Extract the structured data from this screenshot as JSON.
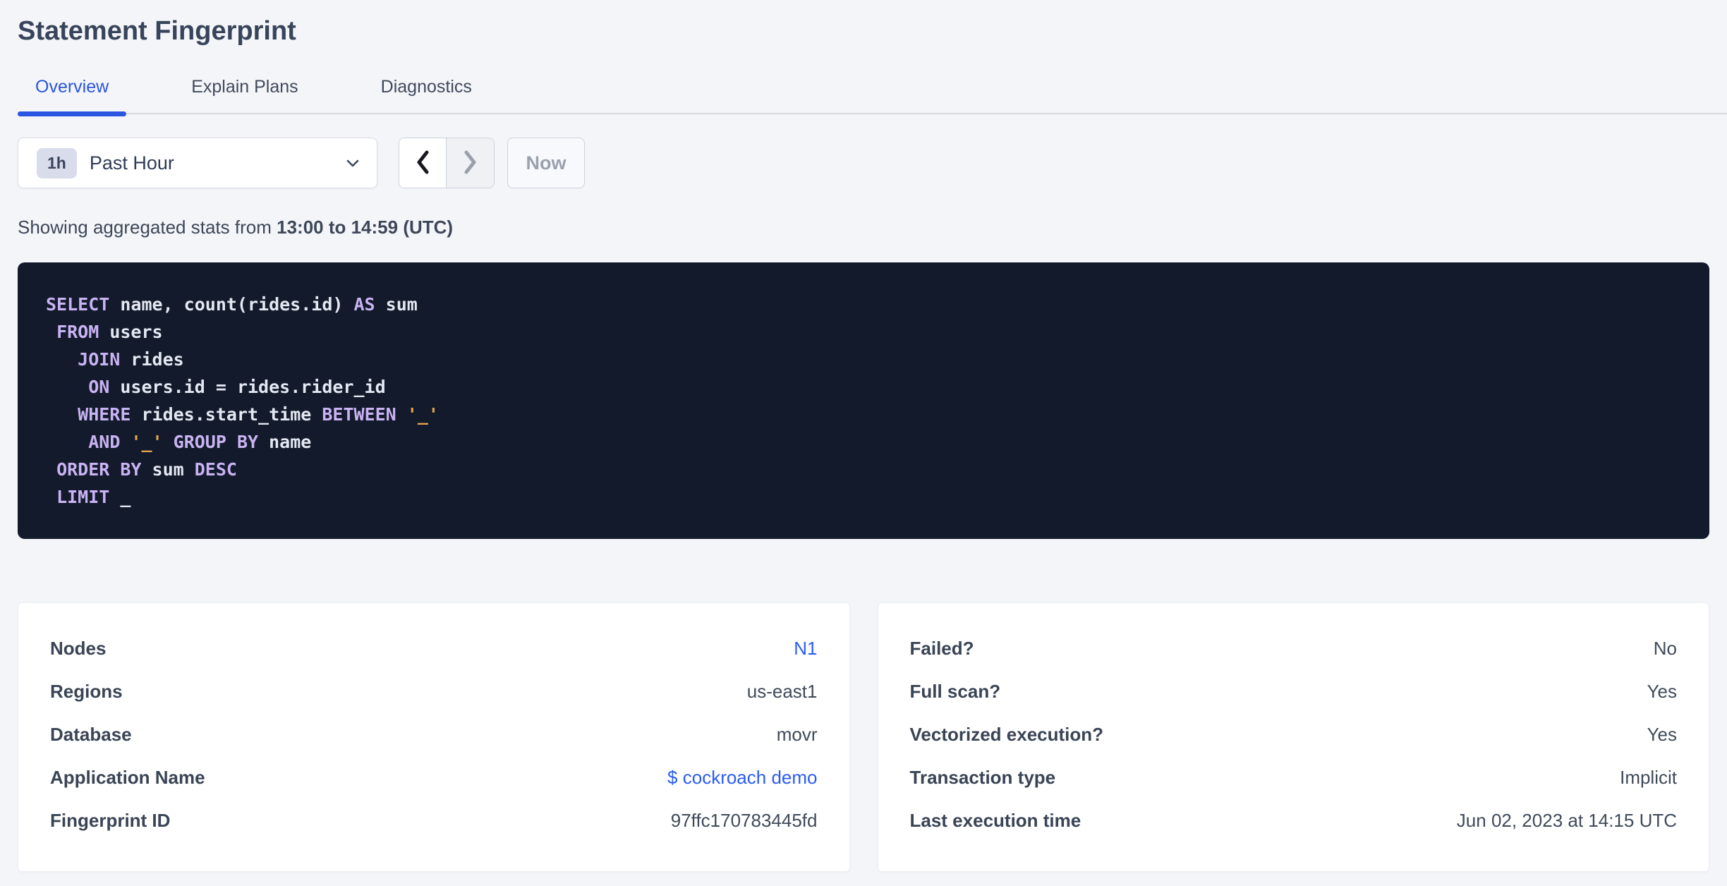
{
  "page": {
    "title": "Statement Fingerprint"
  },
  "tabs": [
    {
      "label": "Overview",
      "active": true
    },
    {
      "label": "Explain Plans",
      "active": false
    },
    {
      "label": "Diagnostics",
      "active": false
    }
  ],
  "time_picker": {
    "badge": "1h",
    "label": "Past Hour",
    "now_label": "Now",
    "prev_enabled": true,
    "next_enabled": false,
    "icons": [
      "chevron-down-icon",
      "chevron-left-icon",
      "chevron-right-icon"
    ]
  },
  "stats_line": {
    "prefix": "Showing aggregated stats from ",
    "bold": "13:00 to 14:59 (UTC)"
  },
  "sql": {
    "lines": [
      {
        "segments": [
          {
            "text": "SELECT",
            "c": "kw"
          },
          {
            "text": " name, count(rides.id) ",
            "c": "id"
          },
          {
            "text": "AS",
            "c": "kw"
          },
          {
            "text": " sum",
            "c": "id"
          }
        ]
      },
      {
        "segments": [
          {
            "text": " ",
            "c": "id"
          },
          {
            "text": "FROM",
            "c": "kw"
          },
          {
            "text": " users",
            "c": "id"
          }
        ]
      },
      {
        "segments": [
          {
            "text": "   ",
            "c": "id"
          },
          {
            "text": "JOIN",
            "c": "kw"
          },
          {
            "text": " rides",
            "c": "id"
          }
        ]
      },
      {
        "segments": [
          {
            "text": "    ",
            "c": "id"
          },
          {
            "text": "ON",
            "c": "kw"
          },
          {
            "text": " users.id = rides.rider_id",
            "c": "id"
          }
        ]
      },
      {
        "segments": [
          {
            "text": "   ",
            "c": "id"
          },
          {
            "text": "WHERE",
            "c": "kw"
          },
          {
            "text": " rides.start_time ",
            "c": "id"
          },
          {
            "text": "BETWEEN",
            "c": "kw"
          },
          {
            "text": " ",
            "c": "id"
          },
          {
            "text": "'_'",
            "c": "str"
          }
        ]
      },
      {
        "segments": [
          {
            "text": "    ",
            "c": "id"
          },
          {
            "text": "AND",
            "c": "kw"
          },
          {
            "text": " ",
            "c": "id"
          },
          {
            "text": "'_'",
            "c": "str"
          },
          {
            "text": " ",
            "c": "id"
          },
          {
            "text": "GROUP BY",
            "c": "kw"
          },
          {
            "text": " name",
            "c": "id"
          }
        ]
      },
      {
        "segments": [
          {
            "text": " ",
            "c": "id"
          },
          {
            "text": "ORDER BY",
            "c": "kw"
          },
          {
            "text": " sum ",
            "c": "id"
          },
          {
            "text": "DESC",
            "c": "kw"
          }
        ]
      },
      {
        "segments": [
          {
            "text": " ",
            "c": "id"
          },
          {
            "text": "LIMIT",
            "c": "kw"
          },
          {
            "text": " _",
            "c": "id"
          }
        ]
      }
    ]
  },
  "cards": {
    "left": {
      "rows": [
        {
          "label": "Nodes",
          "value": "N1",
          "link": true
        },
        {
          "label": "Regions",
          "value": "us-east1",
          "link": false
        },
        {
          "label": "Database",
          "value": "movr",
          "link": false
        },
        {
          "label": "Application Name",
          "value": "$ cockroach demo",
          "link": true
        },
        {
          "label": "Fingerprint ID",
          "value": "97ffc170783445fd",
          "link": false
        }
      ]
    },
    "right": {
      "rows": [
        {
          "label": "Failed?",
          "value": "No",
          "link": false
        },
        {
          "label": "Full scan?",
          "value": "Yes",
          "link": false
        },
        {
          "label": "Vectorized execution?",
          "value": "Yes",
          "link": false
        },
        {
          "label": "Transaction type",
          "value": "Implicit",
          "link": false
        },
        {
          "label": "Last execution time",
          "value": "Jun 02, 2023 at 14:15 UTC",
          "link": false
        }
      ]
    }
  },
  "colors": {
    "page_bg": "#f4f5f9",
    "accent_tab": "#2b55e0",
    "link_blue": "#2a5cf5",
    "sql_bg": "#121a2b",
    "sql_keyword": "#c9b3f2",
    "sql_identifier": "#e4e8f2",
    "sql_string": "#e3a44c"
  }
}
